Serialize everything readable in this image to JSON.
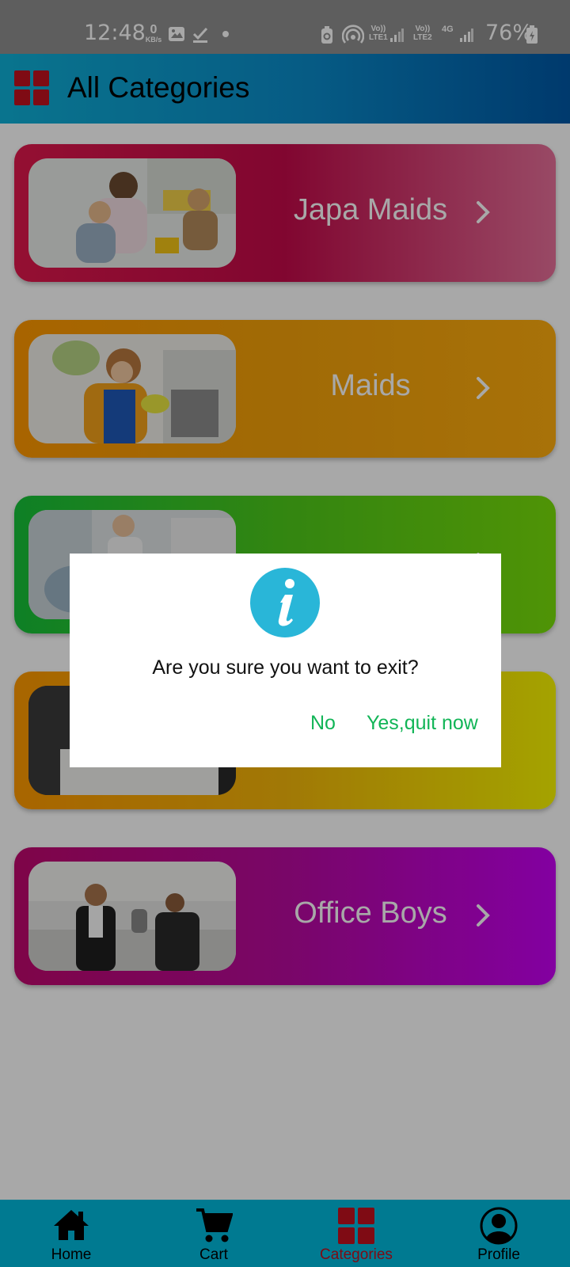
{
  "status_bar": {
    "time": "12:48",
    "net_speed_value": "0",
    "net_speed_unit": "KB/s",
    "sim1_label_top": "Vo))",
    "sim1_label_bottom": "LTE1",
    "sim2_label_top": "Vo))",
    "sim2_label_bottom": "LTE2",
    "network_type": "4G",
    "battery_percent": "76%",
    "icons": [
      "gallery-icon",
      "download-done-icon",
      "dot-icon",
      "battery-saver-icon",
      "hotspot-icon",
      "signal-icon",
      "battery-icon"
    ]
  },
  "app_bar": {
    "title": "All Categories",
    "icon": "categories-grid-icon"
  },
  "categories": [
    {
      "label": "Japa Maids",
      "colors": [
        "#e1184c",
        "#c40a4a",
        "#e8709a"
      ],
      "icon": "chevron-right-icon"
    },
    {
      "label": "Maids",
      "colors": [
        "#ff9800",
        "#f4a20a",
        "#ffad0e"
      ],
      "icon": "chevron-right-icon"
    },
    {
      "label": "",
      "colors": [
        "#16c33a",
        "#4ecb1a",
        "#79e00a"
      ],
      "icon": "chevron-right-icon"
    },
    {
      "label": "",
      "colors": [
        "#ff9a00",
        "#f5b70a",
        "#f9f700"
      ],
      "icon": "chevron-right-icon"
    },
    {
      "label": "Office Boys",
      "colors": [
        "#c0086e",
        "#b80a9e",
        "#c700f4"
      ],
      "icon": "chevron-right-icon"
    }
  ],
  "dialog": {
    "icon": "info-icon",
    "message": "Are you sure you want to exit?",
    "no_label": "No",
    "yes_label": "Yes,quit now",
    "accent_color": "#12b557"
  },
  "bottom_nav": {
    "items": [
      {
        "label": "Home",
        "icon": "home-icon"
      },
      {
        "label": "Cart",
        "icon": "cart-icon"
      },
      {
        "label": "Categories",
        "icon": "categories-icon",
        "active": true
      },
      {
        "label": "Profile",
        "icon": "profile-icon"
      }
    ],
    "active_color": "#c1121f"
  }
}
